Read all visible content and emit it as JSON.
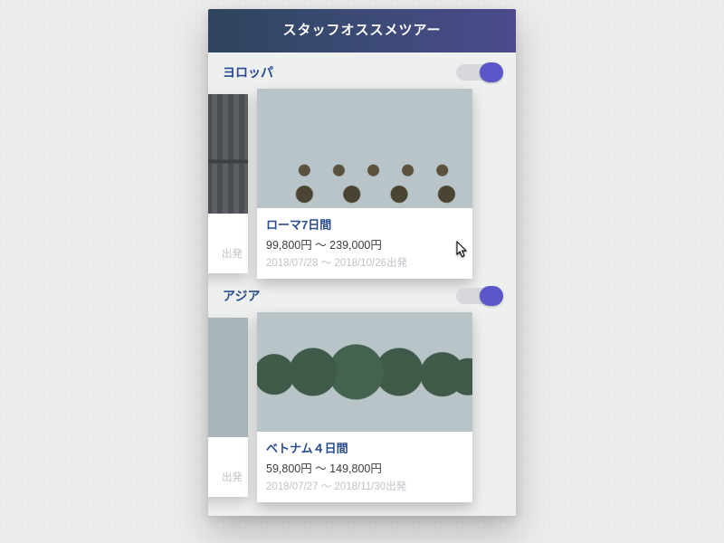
{
  "header": {
    "title": "スタッフオススメツアー"
  },
  "sections": [
    {
      "title": "ヨロッパ",
      "toggle_on": true,
      "peek": {
        "dates_tail": "出発"
      },
      "featured": {
        "title": "ローマ7日間",
        "price": "99,800円 〜 239,000円",
        "dates": "2018/07/28 〜 2018/10/26出発"
      }
    },
    {
      "title": "アジア",
      "toggle_on": true,
      "peek": {
        "dates_tail": "出発"
      },
      "featured": {
        "title": "ベトナム４日間",
        "price": "59,800円 〜 149,800円",
        "dates": "2018/07/27 〜 2018/11/30出発"
      }
    }
  ]
}
